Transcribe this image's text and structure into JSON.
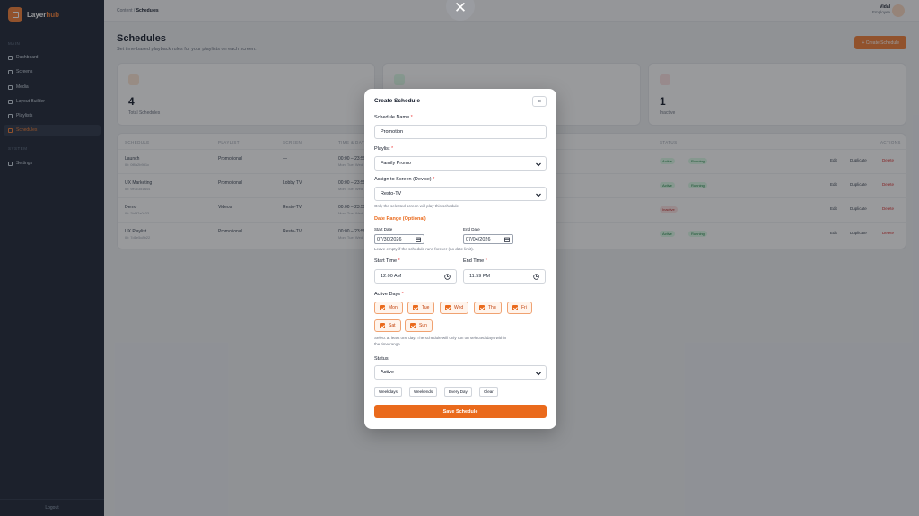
{
  "app": {
    "name_a": "Layer",
    "name_b": "hub"
  },
  "sidebar": {
    "section_main": "MAIN",
    "section_system": "SYSTEM",
    "items": [
      {
        "label": "Dashboard"
      },
      {
        "label": "Screens"
      },
      {
        "label": "Media"
      },
      {
        "label": "Layout Builder"
      },
      {
        "label": "Playlists"
      },
      {
        "label": "Schedules"
      },
      {
        "label": "Settings"
      }
    ],
    "active": "Schedules",
    "logout": "Logout"
  },
  "topbar": {
    "breadcrumb_parent": "Content",
    "breadcrumb_sep": "/",
    "breadcrumb_current": "Schedules",
    "user_name": "Vidal",
    "user_role": "Employee"
  },
  "page": {
    "title": "Schedules",
    "subtitle": "Set time-based playback rules for your playlists on each screen.",
    "create_button": "+ Create Schedule"
  },
  "stats": [
    {
      "value": "4",
      "label": "Total Schedules"
    },
    {
      "value": "",
      "label": ""
    },
    {
      "value": "1",
      "label": "Inactive"
    }
  ],
  "table": {
    "headers": [
      "SCHEDULE",
      "PLAYLIST",
      "SCREEN",
      "TIME & DAYS",
      "STATUS",
      "ACTIONS"
    ],
    "rows": [
      {
        "name": "Launch",
        "sub": "ID: 0f8a2b9d1c",
        "playlist": "Promotional",
        "screen": "—",
        "time": "00:00 – 23:59",
        "time_sub": "Mon, Tue, Wed",
        "badges": [
          "Active",
          "Running"
        ],
        "inactive": false
      },
      {
        "name": "UX Marketing",
        "sub": "ID: 9e7c3d1a44",
        "playlist": "Promotional",
        "screen": "Lobby TV",
        "time": "00:00 – 23:59",
        "time_sub": "Mon, Tue, Wed",
        "badges": [
          "Active",
          "Running"
        ],
        "inactive": false
      },
      {
        "name": "Demo",
        "sub": "ID: 2b9f7a0c33",
        "playlist": "Videos",
        "screen": "Resto-TV",
        "time": "00:00 – 23:59",
        "time_sub": "Mon, Tue, Wed",
        "badges": [
          "Inactive"
        ],
        "inactive": true
      },
      {
        "name": "UX Playlist",
        "sub": "ID: 7d1e5c8b22",
        "playlist": "Promotional",
        "screen": "Resto-TV",
        "time": "00:00 – 23:59",
        "time_sub": "Mon, Tue, Wed",
        "badges": [
          "Active",
          "Running"
        ],
        "inactive": false
      }
    ],
    "actions": {
      "edit": "Edit",
      "duplicate": "Duplicate",
      "delete": "Delete"
    }
  },
  "modal": {
    "close_glyph": "✕",
    "title": "Create Schedule",
    "x_glyph": "×",
    "name_label": "Schedule Name",
    "name_value": "Promotion",
    "playlist_label": "Playlist",
    "playlist_value": "Family Promo",
    "screen_label": "Assign to Screen (Device)",
    "screen_value": "Resto-TV",
    "screen_help": "Only the selected screen will play this schedule.",
    "date_range_label": "Date Range (Optional)",
    "start_date_label": "Start Date",
    "start_date_value": "07/30/2026",
    "end_date_label": "End Date",
    "end_date_value": "07/04/2026",
    "date_help": "Leave empty if the schedule runs forever (no date limit).",
    "start_time_label": "Start Time",
    "start_time_value": "12:00 AM",
    "end_time_label": "End Time",
    "end_time_value": "11:59 PM",
    "days_label": "Active Days",
    "days": [
      "Mon",
      "Tue",
      "Wed",
      "Thu",
      "Fri",
      "Sat",
      "Sun"
    ],
    "days_help_1": "Select at least one day. The schedule will only run on selected days within",
    "days_help_2": "the time range.",
    "status_label": "Status",
    "status_value": "Active",
    "quick": [
      "Weekdays",
      "Weekends",
      "Every Day",
      "Clear"
    ],
    "save": "Save Schedule",
    "required_mark": "*"
  },
  "colors": {
    "accent": "#ea6a1c",
    "sidebar": "#1c2433",
    "overlay": "rgba(28,30,36,0.45)"
  },
  "icons": [
    "close-icon",
    "chevron-down-icon",
    "calendar-icon",
    "clock-icon",
    "checkbox-icon"
  ]
}
